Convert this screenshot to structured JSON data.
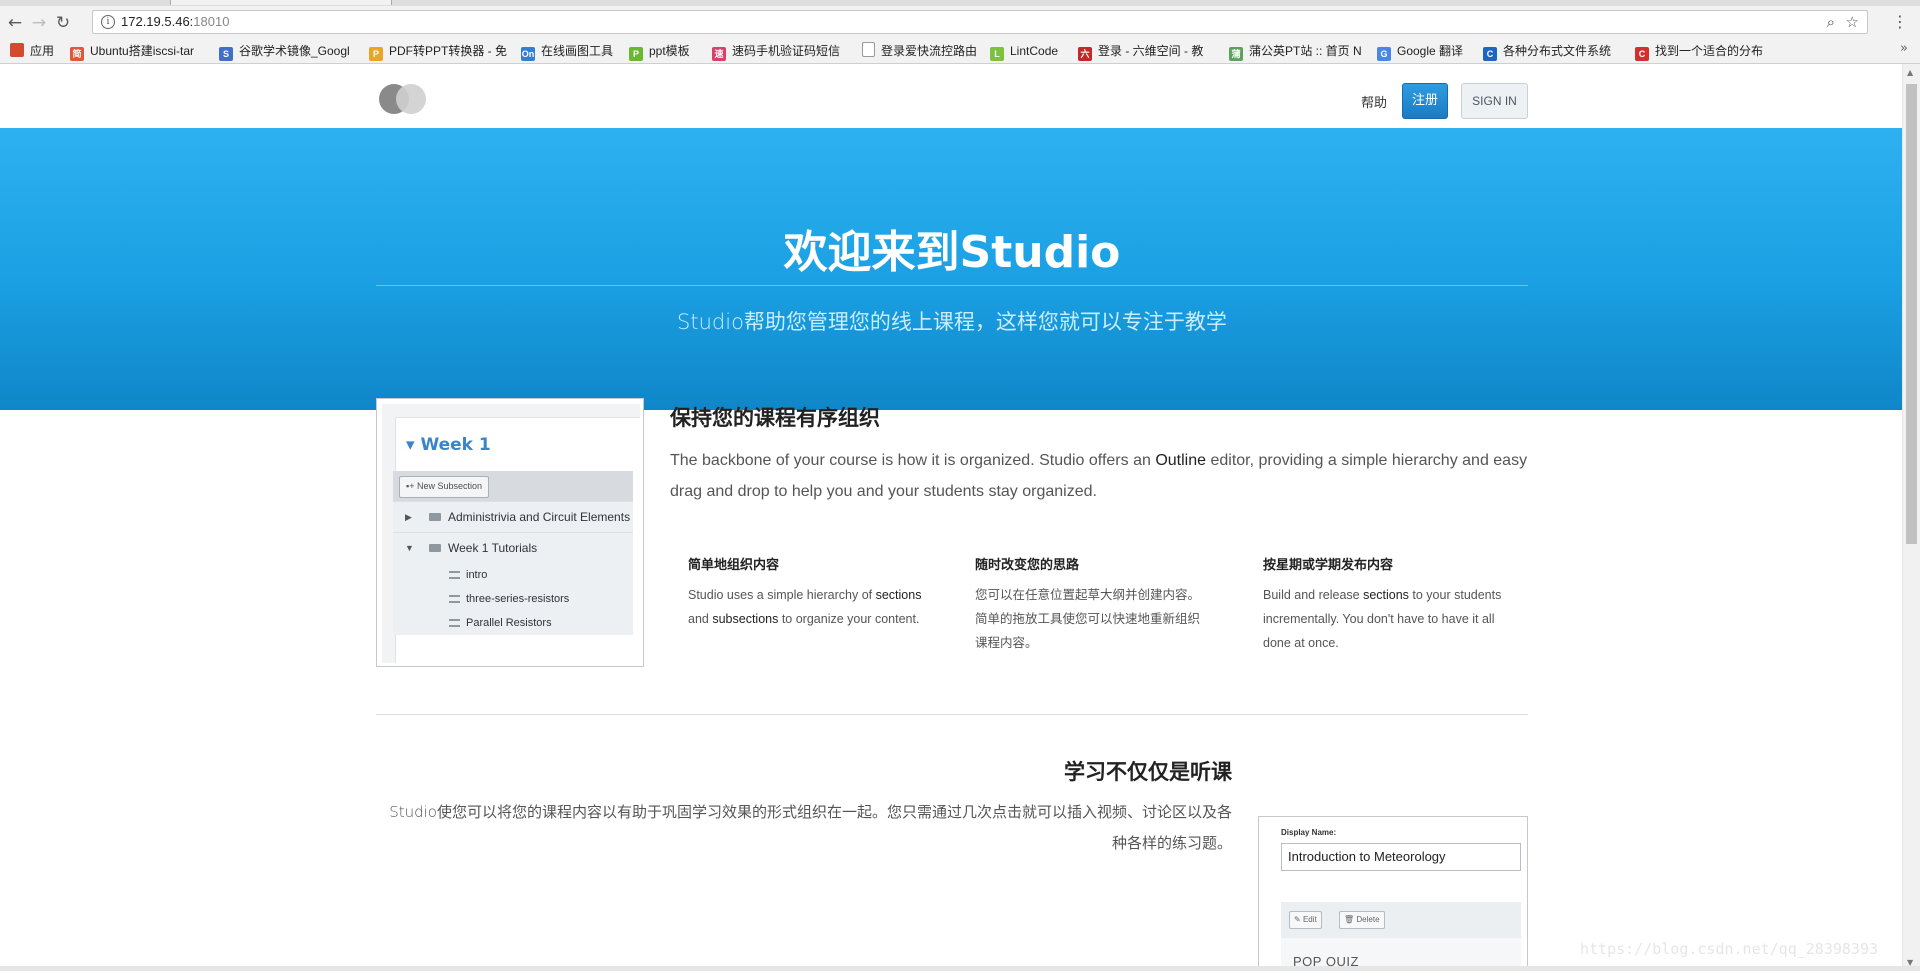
{
  "browser": {
    "back_icon": "←",
    "forward_icon": "→",
    "reload_icon": "↻",
    "info_icon": "i",
    "url_host": "172.19.5.46:",
    "url_port": "18010",
    "zoom_icon": "⌕",
    "star_icon": "☆",
    "menu_icon": "⋮",
    "bookmarks": [
      {
        "label": "应用",
        "color": "#d44a2e",
        "glyph": ""
      },
      {
        "label": "Ubuntu搭建iscsi-tar",
        "color": "#e1573a",
        "glyph": "简"
      },
      {
        "label": "谷歌学术镜像_Googl",
        "color": "#3f6fc9",
        "glyph": "S"
      },
      {
        "label": "PDF转PPT转换器 - 免",
        "color": "#e7a623",
        "glyph": "P"
      },
      {
        "label": "在线画图工具",
        "color": "#2f7fd6",
        "glyph": "On"
      },
      {
        "label": "ppt模板",
        "color": "#6ab82f",
        "glyph": "P"
      },
      {
        "label": "速码手机验证码短信",
        "color": "#d6406b",
        "glyph": "速"
      },
      {
        "label": "登录爱快流控路由",
        "color": "#ffffff",
        "glyph": ""
      },
      {
        "label": "LintCode",
        "color": "#7cc23d",
        "glyph": "L"
      },
      {
        "label": "登录 - 六维空间 - 教",
        "color": "#c62828",
        "glyph": "六"
      },
      {
        "label": "蒲公英PT站 :: 首页 N",
        "color": "#5ba35b",
        "glyph": "蒲"
      },
      {
        "label": "Google 翻译",
        "color": "#4a86e8",
        "glyph": "G"
      },
      {
        "label": "各种分布式文件系统",
        "color": "#1a66c2",
        "glyph": "C"
      },
      {
        "label": "找到一个适合的分布",
        "color": "#d32f2f",
        "glyph": "C"
      }
    ],
    "more_icon": "»"
  },
  "header": {
    "help": "帮助",
    "register": "注册",
    "signin": "SIGN IN"
  },
  "hero": {
    "title": "欢迎来到Studio",
    "subtitle": "Studio帮助您管理您的线上课程，这样您就可以专注于教学"
  },
  "feature1": {
    "title": "保持您的课程有序组织",
    "body_pre": "The backbone of your course is how it is organized. Studio offers an ",
    "body_bold": "Outline",
    "body_post": " editor, providing a simple hierarchy and easy drag and drop to help you and your students stay organized.",
    "screenshot": {
      "week_title": "Week 1",
      "new_subsection": "New Subsection",
      "sections": [
        "Administrivia and Circuit Elements",
        "Week 1 Tutorials"
      ],
      "units": [
        "intro",
        "three-series-resistors",
        "Parallel Resistors"
      ]
    },
    "columns": [
      {
        "title": "简单地组织内容",
        "pre": "Studio uses a simple hierarchy of ",
        "b1": "sections",
        "mid": " and ",
        "b2": "subsections",
        "post": " to organize your content."
      },
      {
        "title": "随时改变您的思路",
        "text": "您可以在任意位置起草大纲并创建内容。简单的拖放工具使您可以快速地重新组织课程内容。"
      },
      {
        "title": "按星期或学期发布内容",
        "pre": "Build and release ",
        "b1": "sections",
        "post": " to your students incrementally. You don't have to have it all done at once."
      }
    ]
  },
  "feature2": {
    "title": "学习不仅仅是听课",
    "body": "Studio使您可以将您的课程内容以有助于巩固学习效果的形式组织在一起。您只需通过几次点击就可以插入视频、讨论区以及各种各样的练习题。",
    "screenshot": {
      "display_name_label": "Display Name:",
      "display_name_value": "Introduction to Meteorology",
      "edit": "Edit",
      "delete": "Delete",
      "quiz": "POP QUIZ"
    }
  },
  "watermark": "https://blog.csdn.net/qq_28398393"
}
